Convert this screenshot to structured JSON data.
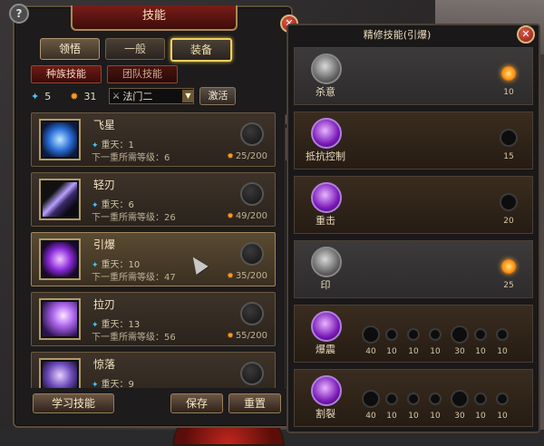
{
  "left": {
    "title": "技能",
    "help": "?",
    "close": "✕",
    "tabs": [
      "领悟",
      "一般",
      "装备"
    ],
    "subtabs": [
      "种族技能",
      "团队技能"
    ],
    "stats": {
      "blue": "5",
      "orange": "31",
      "weapon": "法门二",
      "learn_btn": "激活"
    },
    "skills": [
      {
        "name": "飞星",
        "level": "重天：1",
        "req": "下一重所需等级：6",
        "cost": "25/200"
      },
      {
        "name": "轻刃",
        "level": "重天：6",
        "req": "下一重所需等级：26",
        "cost": "49/200"
      },
      {
        "name": "引爆",
        "level": "重天：10",
        "req": "下一重所需等级：47",
        "cost": "35/200"
      },
      {
        "name": "拉刃",
        "level": "重天：13",
        "req": "下一重所需等级：56",
        "cost": "55/200"
      },
      {
        "name": "惊落",
        "level": "重天：9",
        "req": "",
        "cost": ""
      }
    ],
    "buttons": {
      "learn": "学习技能",
      "save": "保存",
      "reset": "重置"
    }
  },
  "right": {
    "title": "精修技能(引爆)",
    "close": "✕",
    "rows": [
      {
        "label": "杀意",
        "val": "10"
      },
      {
        "label": "抵抗控制",
        "val": "15"
      },
      {
        "label": "重击",
        "val": "20"
      },
      {
        "label": "印",
        "val": "25"
      },
      {
        "label": "爆震",
        "vals": [
          "40",
          "10",
          "10",
          "10",
          "30",
          "10",
          "10"
        ]
      },
      {
        "label": "割裂",
        "vals": [
          "40",
          "10",
          "10",
          "10",
          "30",
          "10",
          "10"
        ]
      }
    ]
  },
  "colors": {
    "accent_gold": "#b29a68",
    "title_red": "#7a1d18",
    "highlight_yellow": "#f0d060"
  }
}
